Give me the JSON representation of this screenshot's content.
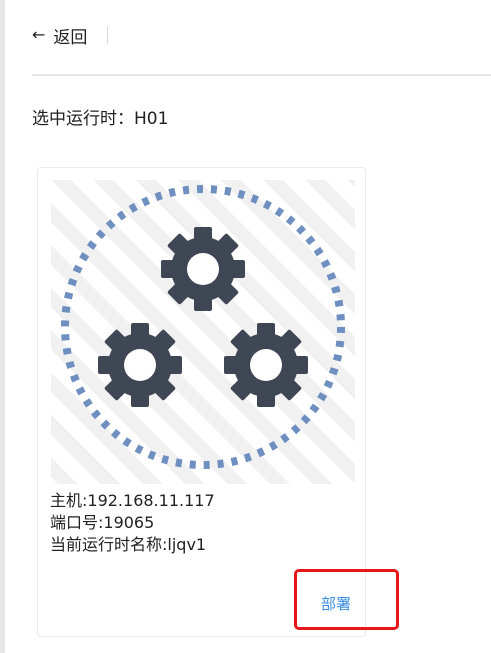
{
  "header": {
    "back_arrow": "←",
    "back_label": "返回"
  },
  "runtime": {
    "selected_label": "选中运行时：H01"
  },
  "card": {
    "image_icon": "gears-icon",
    "host": "主机:192.168.11.117",
    "port": "端口号:19065",
    "runtime_name": "当前运行时名称:ljqv1",
    "deploy_label": "部署"
  },
  "colors": {
    "accent_link": "#3a8ee6",
    "gear": "#3f4654",
    "dots": "#6e8fc0",
    "highlight": "#e8161b"
  }
}
